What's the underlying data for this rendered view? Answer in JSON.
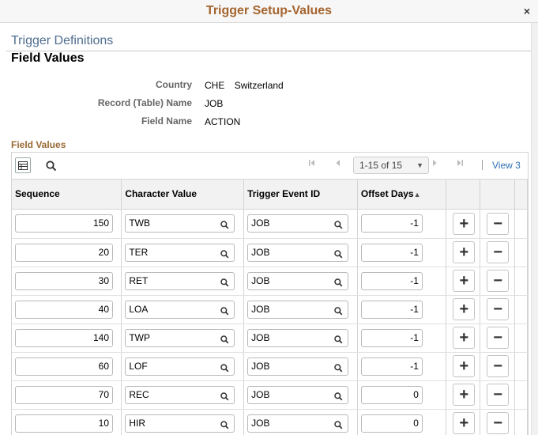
{
  "window": {
    "title": "Trigger Setup-Values",
    "close_glyph": "×"
  },
  "page": {
    "title": "Trigger Definitions",
    "subtitle": "Field Values"
  },
  "fields": [
    {
      "label": "Country",
      "value": "CHE",
      "value2": "Switzerland"
    },
    {
      "label": "Record (Table) Name",
      "value": "JOB"
    },
    {
      "label": "Field Name",
      "value": "ACTION"
    }
  ],
  "grid": {
    "title": "Field Values",
    "pager": "1-15 of 15",
    "view_link": "View 3",
    "columns": [
      "Sequence",
      "Character Value",
      "Trigger Event ID",
      "Offset Days"
    ],
    "sort_indicator": "▲",
    "add_glyph": "+",
    "remove_glyph": "−",
    "rows": [
      {
        "sequence": "150",
        "char_value": "TWB",
        "event_id": "JOB",
        "offset": "-1"
      },
      {
        "sequence": "20",
        "char_value": "TER",
        "event_id": "JOB",
        "offset": "-1"
      },
      {
        "sequence": "30",
        "char_value": "RET",
        "event_id": "JOB",
        "offset": "-1"
      },
      {
        "sequence": "40",
        "char_value": "LOA",
        "event_id": "JOB",
        "offset": "-1"
      },
      {
        "sequence": "140",
        "char_value": "TWP",
        "event_id": "JOB",
        "offset": "-1"
      },
      {
        "sequence": "60",
        "char_value": "LOF",
        "event_id": "JOB",
        "offset": "-1"
      },
      {
        "sequence": "70",
        "char_value": "REC",
        "event_id": "JOB",
        "offset": "0"
      },
      {
        "sequence": "10",
        "char_value": "HIR",
        "event_id": "JOB",
        "offset": "0"
      }
    ]
  },
  "icons": [
    "grid-settings-icon",
    "search-icon",
    "first-page-icon",
    "previous-page-icon",
    "next-page-icon",
    "last-page-icon",
    "lookup-icon"
  ],
  "colors": {
    "title": "#a5642e",
    "page_title": "#4f6d8f",
    "section_title": "#9b6a35",
    "link": "#2d6fb3"
  }
}
